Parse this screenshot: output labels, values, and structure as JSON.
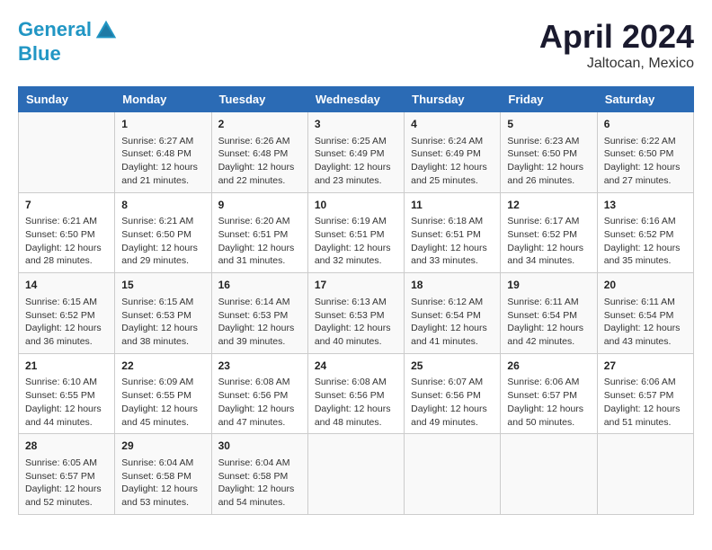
{
  "header": {
    "logo_line1": "General",
    "logo_line2": "Blue",
    "month_year": "April 2024",
    "location": "Jaltocan, Mexico"
  },
  "days_of_week": [
    "Sunday",
    "Monday",
    "Tuesday",
    "Wednesday",
    "Thursday",
    "Friday",
    "Saturday"
  ],
  "weeks": [
    [
      {
        "day": "",
        "content": ""
      },
      {
        "day": "1",
        "content": "Sunrise: 6:27 AM\nSunset: 6:48 PM\nDaylight: 12 hours\nand 21 minutes."
      },
      {
        "day": "2",
        "content": "Sunrise: 6:26 AM\nSunset: 6:48 PM\nDaylight: 12 hours\nand 22 minutes."
      },
      {
        "day": "3",
        "content": "Sunrise: 6:25 AM\nSunset: 6:49 PM\nDaylight: 12 hours\nand 23 minutes."
      },
      {
        "day": "4",
        "content": "Sunrise: 6:24 AM\nSunset: 6:49 PM\nDaylight: 12 hours\nand 25 minutes."
      },
      {
        "day": "5",
        "content": "Sunrise: 6:23 AM\nSunset: 6:50 PM\nDaylight: 12 hours\nand 26 minutes."
      },
      {
        "day": "6",
        "content": "Sunrise: 6:22 AM\nSunset: 6:50 PM\nDaylight: 12 hours\nand 27 minutes."
      }
    ],
    [
      {
        "day": "7",
        "content": "Sunrise: 6:21 AM\nSunset: 6:50 PM\nDaylight: 12 hours\nand 28 minutes."
      },
      {
        "day": "8",
        "content": "Sunrise: 6:21 AM\nSunset: 6:50 PM\nDaylight: 12 hours\nand 29 minutes."
      },
      {
        "day": "9",
        "content": "Sunrise: 6:20 AM\nSunset: 6:51 PM\nDaylight: 12 hours\nand 31 minutes."
      },
      {
        "day": "10",
        "content": "Sunrise: 6:19 AM\nSunset: 6:51 PM\nDaylight: 12 hours\nand 32 minutes."
      },
      {
        "day": "11",
        "content": "Sunrise: 6:18 AM\nSunset: 6:51 PM\nDaylight: 12 hours\nand 33 minutes."
      },
      {
        "day": "12",
        "content": "Sunrise: 6:17 AM\nSunset: 6:52 PM\nDaylight: 12 hours\nand 34 minutes."
      },
      {
        "day": "13",
        "content": "Sunrise: 6:16 AM\nSunset: 6:52 PM\nDaylight: 12 hours\nand 35 minutes."
      }
    ],
    [
      {
        "day": "14",
        "content": "Sunrise: 6:15 AM\nSunset: 6:52 PM\nDaylight: 12 hours\nand 36 minutes."
      },
      {
        "day": "15",
        "content": "Sunrise: 6:15 AM\nSunset: 6:53 PM\nDaylight: 12 hours\nand 38 minutes."
      },
      {
        "day": "16",
        "content": "Sunrise: 6:14 AM\nSunset: 6:53 PM\nDaylight: 12 hours\nand 39 minutes."
      },
      {
        "day": "17",
        "content": "Sunrise: 6:13 AM\nSunset: 6:53 PM\nDaylight: 12 hours\nand 40 minutes."
      },
      {
        "day": "18",
        "content": "Sunrise: 6:12 AM\nSunset: 6:54 PM\nDaylight: 12 hours\nand 41 minutes."
      },
      {
        "day": "19",
        "content": "Sunrise: 6:11 AM\nSunset: 6:54 PM\nDaylight: 12 hours\nand 42 minutes."
      },
      {
        "day": "20",
        "content": "Sunrise: 6:11 AM\nSunset: 6:54 PM\nDaylight: 12 hours\nand 43 minutes."
      }
    ],
    [
      {
        "day": "21",
        "content": "Sunrise: 6:10 AM\nSunset: 6:55 PM\nDaylight: 12 hours\nand 44 minutes."
      },
      {
        "day": "22",
        "content": "Sunrise: 6:09 AM\nSunset: 6:55 PM\nDaylight: 12 hours\nand 45 minutes."
      },
      {
        "day": "23",
        "content": "Sunrise: 6:08 AM\nSunset: 6:56 PM\nDaylight: 12 hours\nand 47 minutes."
      },
      {
        "day": "24",
        "content": "Sunrise: 6:08 AM\nSunset: 6:56 PM\nDaylight: 12 hours\nand 48 minutes."
      },
      {
        "day": "25",
        "content": "Sunrise: 6:07 AM\nSunset: 6:56 PM\nDaylight: 12 hours\nand 49 minutes."
      },
      {
        "day": "26",
        "content": "Sunrise: 6:06 AM\nSunset: 6:57 PM\nDaylight: 12 hours\nand 50 minutes."
      },
      {
        "day": "27",
        "content": "Sunrise: 6:06 AM\nSunset: 6:57 PM\nDaylight: 12 hours\nand 51 minutes."
      }
    ],
    [
      {
        "day": "28",
        "content": "Sunrise: 6:05 AM\nSunset: 6:57 PM\nDaylight: 12 hours\nand 52 minutes."
      },
      {
        "day": "29",
        "content": "Sunrise: 6:04 AM\nSunset: 6:58 PM\nDaylight: 12 hours\nand 53 minutes."
      },
      {
        "day": "30",
        "content": "Sunrise: 6:04 AM\nSunset: 6:58 PM\nDaylight: 12 hours\nand 54 minutes."
      },
      {
        "day": "",
        "content": ""
      },
      {
        "day": "",
        "content": ""
      },
      {
        "day": "",
        "content": ""
      },
      {
        "day": "",
        "content": ""
      }
    ]
  ]
}
